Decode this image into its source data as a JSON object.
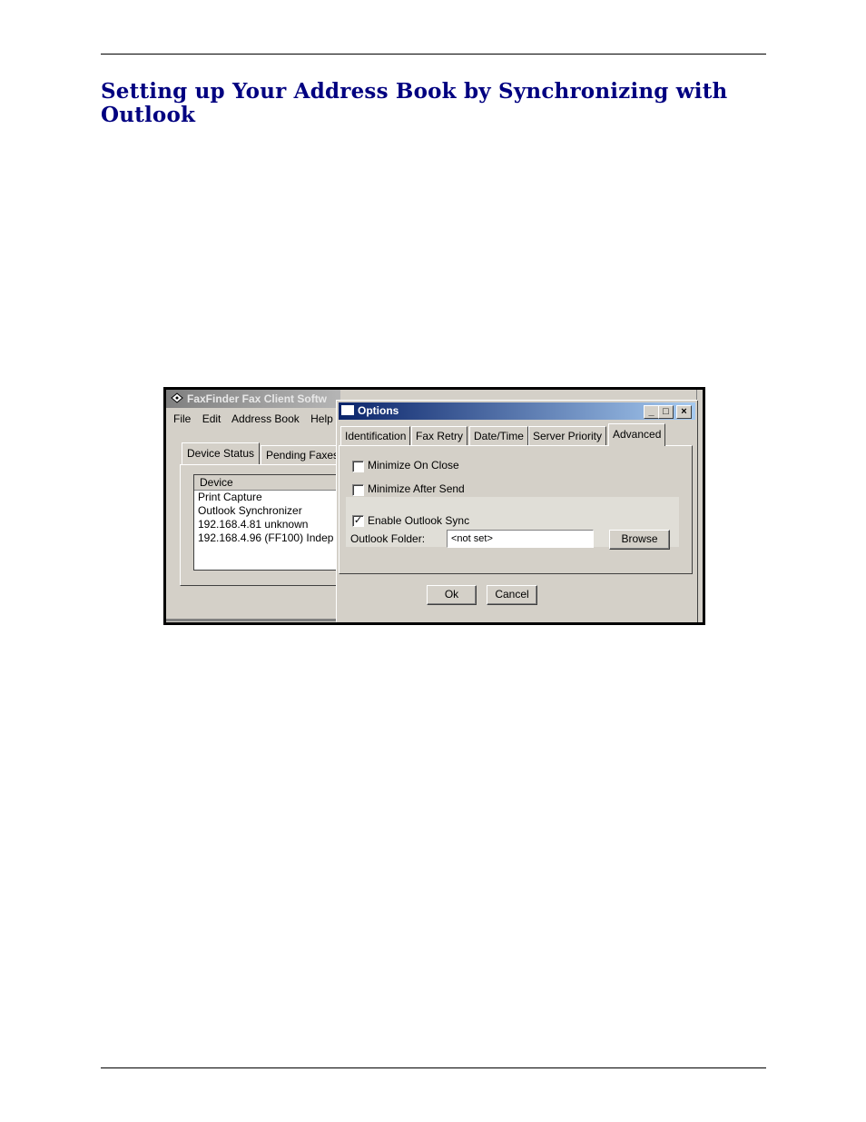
{
  "heading": "Setting up Your Address Book by Synchronizing with Outlook",
  "main_window": {
    "title": "FaxFinder Fax Client Softw",
    "menu": [
      "File",
      "Edit",
      "Address Book",
      "Help"
    ],
    "tabs": [
      "Device Status",
      "Pending Faxes"
    ],
    "list_header": "Device",
    "devices": [
      "Print Capture",
      "Outlook Synchronizer",
      "192.168.4.81  unknown",
      "192.168.4.96 (FF100) Indep"
    ]
  },
  "dialog": {
    "title": "Options",
    "title_buttons": [
      "_",
      "□",
      "×"
    ],
    "tabs": [
      "Identification",
      "Fax Retry",
      "Date/Time",
      "Server Priority",
      "Advanced"
    ],
    "active_tab": "Advanced",
    "minimize_on_close": {
      "label": "Minimize On Close",
      "checked": false
    },
    "minimize_after_send": {
      "label": "Minimize After Send",
      "checked": false
    },
    "enable_outlook_sync": {
      "label": "Enable Outlook Sync",
      "checked": true,
      "mark": "✓"
    },
    "outlook_folder_label": "Outlook Folder:",
    "outlook_folder_value": "<not set>",
    "browse_label": "Browse",
    "ok_label": "Ok",
    "cancel_label": "Cancel"
  },
  "colors": {
    "heading": "#000080",
    "dialog_title_start": "#0a246a",
    "dialog_title_end": "#a6caf0",
    "window_face": "#d4d0c8"
  }
}
